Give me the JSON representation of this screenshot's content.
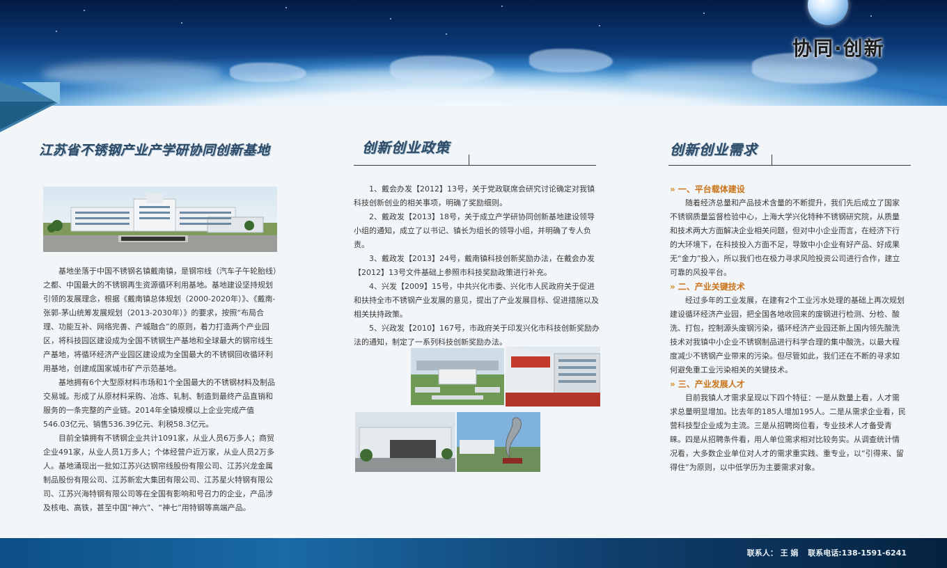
{
  "header": {
    "slogan": "协同·创新"
  },
  "left": {
    "title": "江苏省不锈钢产业产学研协同创新基地",
    "paragraphs": [
      "基地坐落于中国不锈钢名镇戴南镇，是钢帘线（汽车子午轮胎线）之都、中国最大的不锈钢再生资源循环利用基地。基地建设坚持规划引领的发展理念，根据《戴南镇总体规划（2000-2020年）》、《戴南-张郭-茅山统筹发展规划（2013-2030年）》的要求，按照“布局合理、功能互补、网络完善、产城融合”的原则，着力打造两个产业园区，将科技园区建设成为全国不锈钢生产基地和全球最大的钢帘线生产基地，将循环经济产业园区建设成为全国最大的不锈钢回收循环利用基地，创建成国家城市矿产示范基地。",
      "基地拥有6个大型原材料市场和1个全国最大的不锈钢材料及制品交易城。形成了从原材料采购、冶炼、轧制、制造到最终产品直销和服务的一条完整的产业链。2014年全镇规模以上企业完成产值546.03亿元、销售536.39亿元、利税58.3亿元。",
      "目前全镇拥有不锈钢企业共计1091家，从业人员6万多人；商贸企业491家，从业人员1万多人；个体经营户近万家，从业人员2万多人。基地涌现出一批如江苏兴达钢帘线股份有限公司、江苏兴龙金属制品股份有限公司、江苏新宏大集团有限公司、江苏星火特钢有限公司、江苏兴海特钢有限公司等在全国有影响和号召力的企业，产品涉及核电、高铁，甚至中国“神六”、“神七”用特钢等高端产品。"
    ]
  },
  "middle": {
    "title": "创新创业政策",
    "paragraphs": [
      "1、戴会办发【2012】13号，关于党政联席会研究讨论确定对我镇科技创新创业的相关事项，明确了奖励细则。",
      "2、戴政发【2013】18号，关于成立产学研协同创新基地建设领导小组的通知，成立了以书记、镇长为组长的领导小组，并明确了专人负责。",
      "3、戴政发【2013】24号，戴南镇科技创新奖励办法，在戴会办发【2012】13号文件基础上参照市科技奖励政策进行补充。",
      "4、兴发【2009】15号，中共兴化市委、兴化市人民政府关于促进和扶持全市不锈钢产业发展的意见，提出了产业发展目标、促进措施以及相关扶持政策。",
      "5、兴政发【2010】167号，市政府关于印发兴化市科技创新奖励办法的通知，制定了一系列科技创新奖励办法。"
    ]
  },
  "right": {
    "title": "创新创业需求",
    "sections": [
      {
        "heading": "一、平台载体建设",
        "text": "随着经济总量和产品技术含量的不断提升，我们先后成立了国家不锈钢质量监督检验中心，上海大学兴化特种不锈钢研究院，从质量和技术两大方面解决企业相关问题，但对中小企业而言，在经济下行的大环境下，在科技投入方面不足，导致中小企业有好产品、好成果无“金力”投入，所以我们也在极力寻求风险投资公司进行合作，建立可靠的风投平台。"
      },
      {
        "heading": "二、产业关键技术",
        "text": "经过多年的工业发展，在建有2个工业污水处理的基础上再次规划建设循环经济产业园，把全国各地收回来的废钢进行检测、分检、酸洗、打包，控制源头废钢污染，循环经济产业园还新上国内领先酸洗技术对我镇中小企业不锈钢制品进行科学合理的集中酸洗，以最大程度减少不锈钢产业带来的污染。但尽管如此，我们还在不断的寻求如何避免重工业污染相关的关键技术。"
      },
      {
        "heading": "三、产业发展人才",
        "text": "目前我镇人才需求呈现以下四个特征：一是从数量上看，人才需求总量明显增加。比去年的185人增加195人。二是从需求企业看，民营科技型企业成为主流。三是从招聘岗位看，专业技术人才备受青睐。四是从招聘条件看，用人单位需求相对比较务实。从调查统计情况看，大多数企业单位对人才的需求重实践、重专业，以“引得来、留得住”为原则，以中低学历为主要需求对象。"
      }
    ]
  },
  "footer": {
    "contact_label": "联系人：",
    "contact_name": "王  娟",
    "phone_label": "联系电话:",
    "phone": "138-1591-6241"
  },
  "colors": {
    "accent_orange": "#c9741a",
    "title_blue": "#2d4b66",
    "footer_blue": "#0d4f86"
  }
}
